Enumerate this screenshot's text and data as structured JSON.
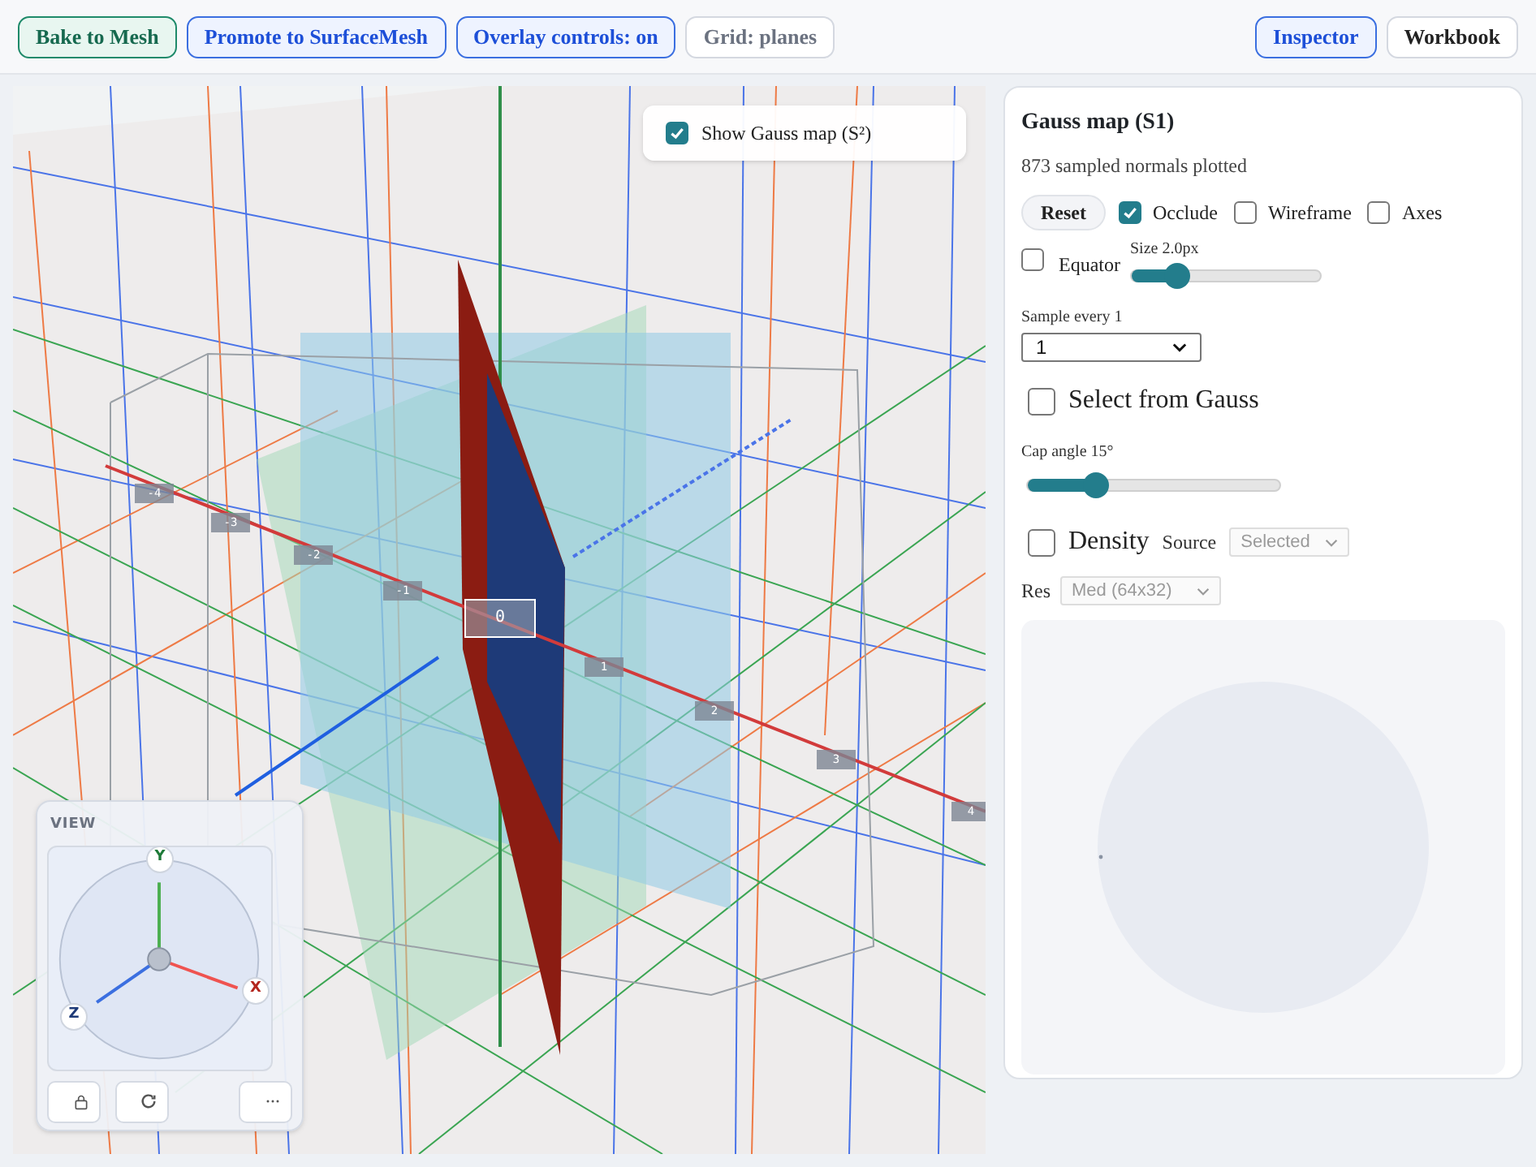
{
  "toolbar": {
    "left_buttons": [
      {
        "label": "Bake to Mesh",
        "kind": "green"
      },
      {
        "label": "Promote to SurfaceMesh",
        "kind": "blue"
      },
      {
        "label": "Overlay controls: on",
        "kind": "blue"
      },
      {
        "label": "Grid: planes",
        "kind": "gray"
      }
    ],
    "right_buttons": [
      {
        "label": "Inspector",
        "selected": true
      },
      {
        "label": "Workbook",
        "selected": false
      }
    ]
  },
  "viewport": {
    "overlay_toggle": {
      "label": "Show Gauss map (S²)",
      "checked": true
    },
    "axis_ticks": [
      "-4",
      "-3",
      "-2",
      "-1",
      "0",
      "1",
      "2",
      "3",
      "4"
    ],
    "view_widget": {
      "title": "VIEW",
      "axes": [
        {
          "label": "Y",
          "kind": "y"
        },
        {
          "label": "X",
          "kind": "x"
        },
        {
          "label": "Z",
          "kind": "z"
        }
      ]
    }
  },
  "panel": {
    "title": "Gauss map (S1)",
    "subtitle": "873 sampled normals plotted",
    "reset_label": "Reset",
    "toggles": [
      {
        "label": "Occlude",
        "checked": true
      },
      {
        "label": "Wireframe",
        "checked": false
      },
      {
        "label": "Axes",
        "checked": false
      }
    ],
    "equator": {
      "label": "Equator",
      "checked": false
    },
    "size_slider": {
      "label": "Size 2.0px",
      "level": 0.24
    },
    "sample": {
      "label": "Sample every 1",
      "value": "1"
    },
    "select_from_gauss": {
      "label": "Select from Gauss",
      "checked": false
    },
    "cap_slider": {
      "label": "Cap angle 15°",
      "level": 0.27
    },
    "density": {
      "label": "Density",
      "checked": false,
      "source_label": "Source",
      "source_value": "Selected",
      "disabled": true
    },
    "res": {
      "label": "Res",
      "value": "Med (64x32)",
      "disabled": true
    }
  }
}
